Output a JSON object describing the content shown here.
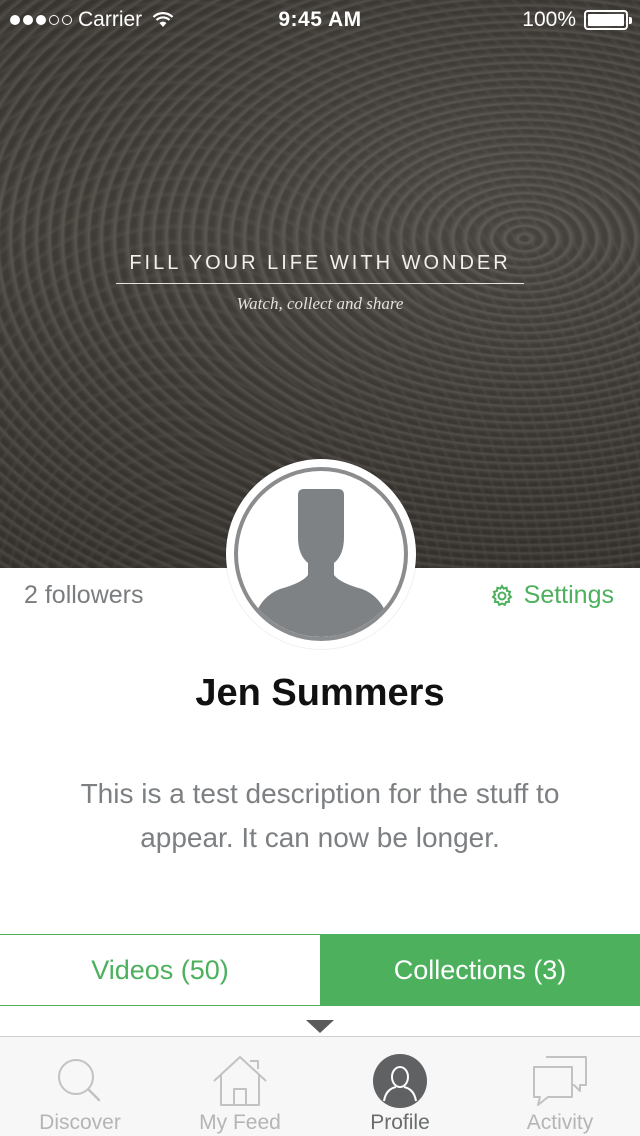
{
  "status_bar": {
    "carrier": "Carrier",
    "time": "9:45 AM",
    "battery": "100%",
    "signal_bars_filled": 3,
    "signal_bars_total": 5
  },
  "hero": {
    "tagline": "FILL YOUR LIFE WITH WONDER",
    "subtitle": "Watch, collect and share"
  },
  "profile": {
    "followers": "2 followers",
    "settings_label": "Settings",
    "name": "Jen Summers",
    "description": "This is a test description for the stuff to appear. It can now be longer."
  },
  "tabs": [
    {
      "label": "Videos (50)",
      "selected": false
    },
    {
      "label": "Collections (3)",
      "selected": true
    }
  ],
  "tab_bar": [
    {
      "label": "Discover",
      "icon": "search-icon",
      "active": false
    },
    {
      "label": "My Feed",
      "icon": "home-icon",
      "active": false
    },
    {
      "label": "Profile",
      "icon": "profile-icon",
      "active": true
    },
    {
      "label": "Activity",
      "icon": "chat-bubbles-icon",
      "active": false
    }
  ],
  "colors": {
    "accent": "#4cb05c",
    "muted_text": "#7d8083",
    "tab_bar_bg": "#f7f7f7"
  }
}
